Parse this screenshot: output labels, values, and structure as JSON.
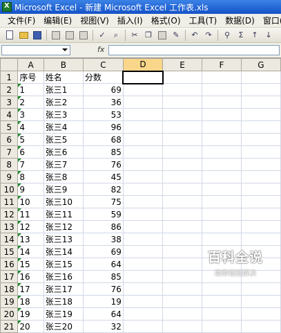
{
  "window": {
    "title": "Microsoft Excel - 新建 Microsoft Excel 工作表.xls"
  },
  "menu": [
    "文件(F)",
    "编辑(E)",
    "视图(V)",
    "插入(I)",
    "格式(O)",
    "工具(T)",
    "数据(D)",
    "窗口(W)"
  ],
  "formula_bar": {
    "name_box": "",
    "fx_label": "fx",
    "formula": ""
  },
  "columns": [
    "A",
    "B",
    "C",
    "D",
    "E",
    "F",
    "G"
  ],
  "selected_column": "D",
  "rows": [
    [
      "序号",
      "姓名",
      "分数"
    ],
    [
      "1",
      "张三1",
      "69"
    ],
    [
      "2",
      "张三2",
      "36"
    ],
    [
      "3",
      "张三3",
      "53"
    ],
    [
      "4",
      "张三4",
      "96"
    ],
    [
      "5",
      "张三5",
      "68"
    ],
    [
      "6",
      "张三6",
      "85"
    ],
    [
      "7",
      "张三7",
      "76"
    ],
    [
      "8",
      "张三8",
      "45"
    ],
    [
      "9",
      "张三9",
      "82"
    ],
    [
      "10",
      "张三10",
      "75"
    ],
    [
      "11",
      "张三11",
      "59"
    ],
    [
      "12",
      "张三12",
      "86"
    ],
    [
      "13",
      "张三13",
      "38"
    ],
    [
      "14",
      "张三14",
      "69"
    ],
    [
      "15",
      "张三15",
      "64"
    ],
    [
      "16",
      "张三16",
      "85"
    ],
    [
      "17",
      "张三17",
      "76"
    ],
    [
      "18",
      "张三18",
      "19"
    ],
    [
      "19",
      "张三19",
      "64"
    ],
    [
      "20",
      "张三20",
      "32"
    ]
  ],
  "watermark": {
    "main": "百科全说",
    "sub": "助你轻松解决"
  },
  "colors": {
    "title_bar": "#1452c8",
    "selected_header": "#f9d68a",
    "error_flag": "#1c8a2c"
  }
}
